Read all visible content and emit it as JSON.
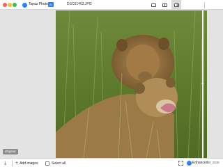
{
  "titlebar": {
    "app_name": "Topaz Photo",
    "badge": "AI",
    "filename": "DSC01463.JPG"
  },
  "view_modes": {
    "single_icon": "single-view-icon",
    "side_by_side_icon": "side-by-side-icon",
    "split_icon": "split-view-icon",
    "active": "split"
  },
  "canvas": {
    "original_label": "Original",
    "split_handle": "↔"
  },
  "bottombar": {
    "download_icon": "⤓",
    "add_plus": "+",
    "add_images": "Add images",
    "select_all": "Select all",
    "enhanced": "Enhanced",
    "dimensions": "W: 2835"
  },
  "colors": {
    "accent": "#2d7ff9",
    "close": "#fe5f57",
    "minimize": "#febc2e",
    "maximize": "#28c840"
  }
}
